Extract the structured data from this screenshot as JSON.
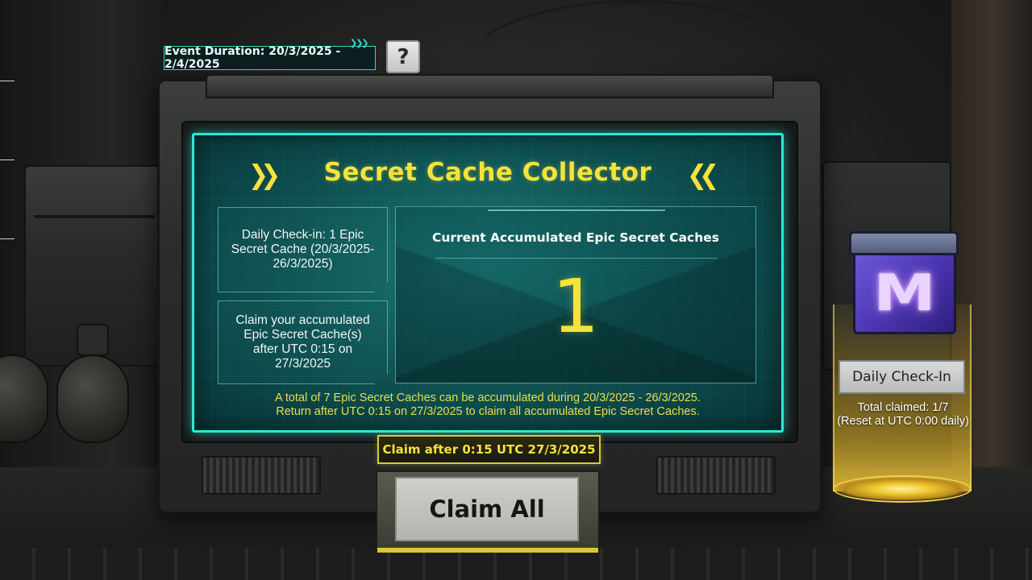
{
  "event": {
    "duration_label": "Event Duration: 20/3/2025 - 2/4/2025",
    "help_label": "?"
  },
  "panel": {
    "title": "Secret Cache Collector",
    "chevrons_left": "❯❯",
    "chevrons_right": "❮❮",
    "daily_checkin_info": "Daily Check-in: 1 Epic Secret Cache (20/3/2025-26/3/2025)",
    "claim_info": "Claim your accumulated Epic Secret Cache(s) after UTC 0:15 on 27/3/2025",
    "accumulated_label": "Current Accumulated Epic Secret Caches",
    "accumulated_value": "1",
    "notice_line1": "A total of 7 Epic Secret Caches can be accumulated during 20/3/2025 - 26/3/2025.",
    "notice_line2": "Return after UTC 0:15 on 27/3/2025 to claim all accumulated Epic Secret Caches."
  },
  "claim": {
    "after_label": "Claim after 0:15 UTC 27/3/2025",
    "button_label": "Claim All"
  },
  "daily_checkin": {
    "label": "Daily Check-In",
    "total_claimed": "Total claimed: 1/7",
    "reset_note": "(Reset at UTC 0:00 daily)"
  },
  "colors": {
    "accent_yellow": "#f4e33a",
    "screen_teal": "#2fe6d6",
    "cache_purple": "#5a44c4"
  },
  "icons": {
    "help": "question-mark-icon",
    "cache": "epic-secret-cache-icon",
    "arrows": "double-chevron-icon"
  }
}
